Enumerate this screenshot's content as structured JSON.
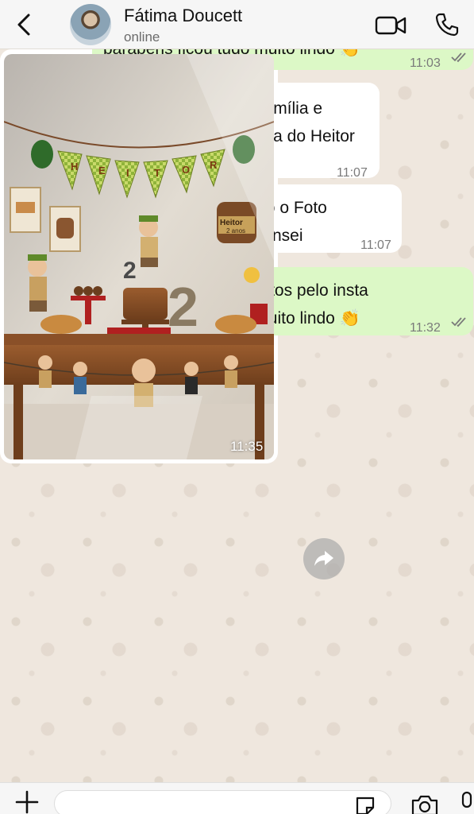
{
  "contact": {
    "name": "Fátima Doucett",
    "status": "online"
  },
  "messages": [
    {
      "dir": "out",
      "text": "parabéns ficou tudo muito lindo 👏",
      "time": "11:03"
    },
    {
      "dir": "in",
      "text": "Passando pra dizer que minha família e amigos elogiaram muito a festinha do Heitor",
      "time": "11:07"
    },
    {
      "dir": "in",
      "text": "To mto satisfeito por ter adquirido o Foto festa é mto mais fassil do que pensei",
      "time": "11:07"
    },
    {
      "dir": "out",
      "text": "Olá Fátima, eu vi as fotos pelo insta parabéns ficou tudo muito lindo 👏",
      "time": "11:32"
    },
    {
      "dir": "in",
      "type": "photo",
      "time": "11:35",
      "photo": {
        "banner_letters": [
          "H",
          "E",
          "I",
          "T",
          "O",
          "R"
        ],
        "sign_name": "Heitor",
        "sign_age": "2 anos",
        "cake_number": "2"
      }
    }
  ],
  "composer": {
    "placeholder": ""
  },
  "colors": {
    "incoming": "#ffffff",
    "outgoing": "#dcf8c6",
    "background": "#efe7de",
    "ticks": "#7a7a7a"
  }
}
